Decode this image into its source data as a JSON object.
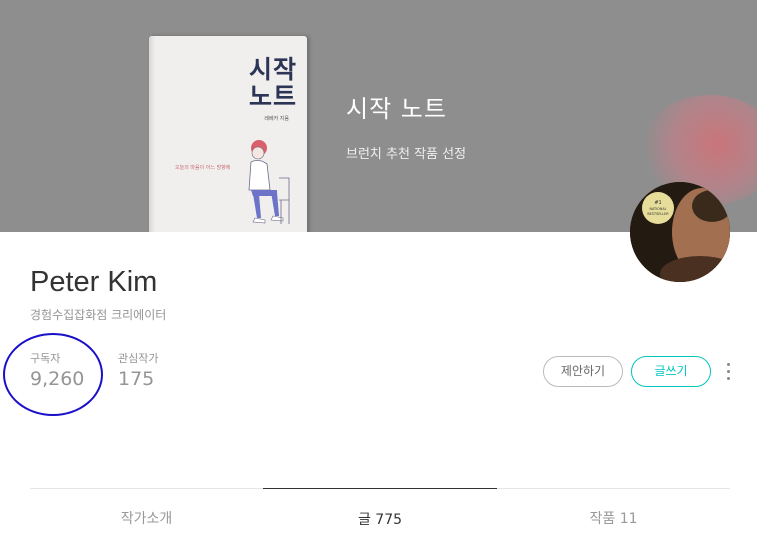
{
  "cover": {
    "book": {
      "title_line1": "시작",
      "title_line2": "노트",
      "author": "레베카 지음",
      "tagline": "오늘의 마음이 어느 방향에"
    },
    "title": "시작 노트",
    "subtitle": "브런치 추천 작품 선정",
    "avatar_badge": "#1 NATIONAL BESTSELLER"
  },
  "profile": {
    "name": "Peter Kim",
    "role": "경험수집잡화점 크리에이터",
    "stats": [
      {
        "label": "구독자",
        "value": "9,260"
      },
      {
        "label": "관심작가",
        "value": "175"
      }
    ],
    "buttons": {
      "suggest": "제안하기",
      "write": "글쓰기"
    }
  },
  "tabs": [
    {
      "label": "작가소개",
      "active": false
    },
    {
      "label": "글 775",
      "active": true
    },
    {
      "label": "작품 11",
      "active": false
    }
  ],
  "colors": {
    "accent": "#00c6be",
    "annotation": "#1a10c8",
    "cover_bg": "#8e8e8e"
  },
  "icons": {
    "more": "more-vertical-icon"
  }
}
